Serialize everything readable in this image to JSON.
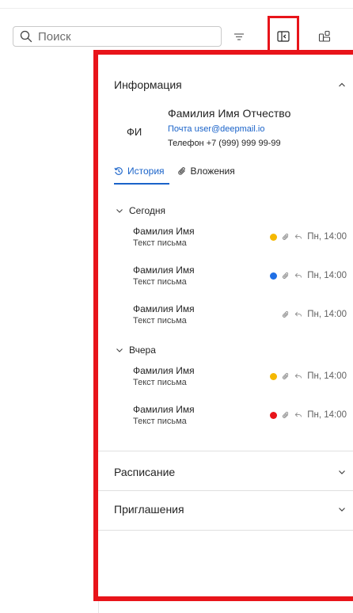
{
  "search": {
    "placeholder": "Поиск"
  },
  "panel": {
    "info_section": {
      "title": "Информация",
      "fio_label": "ФИ",
      "full_name": "Фамилия Имя Отчество",
      "email_label": "Почта",
      "email": "user@deepmail.io",
      "phone_label": "Телефон",
      "phone": "+7 (999) 999 99-99"
    },
    "tabs": [
      {
        "label": "История",
        "icon": "history-icon",
        "active": true
      },
      {
        "label": "Вложения",
        "icon": "paperclip-icon",
        "active": false
      }
    ],
    "groups": [
      {
        "label": "Сегодня",
        "items": [
          {
            "sender": "Фамилия Имя",
            "snippet": "Текст письма",
            "dot_color": "#f5b800",
            "time": "Пн, 14:00"
          },
          {
            "sender": "Фамилия Имя",
            "snippet": "Текст письма",
            "dot_color": "#1f6fe5",
            "time": "Пн, 14:00"
          },
          {
            "sender": "Фамилия Имя",
            "snippet": "Текст письма",
            "dot_color": "",
            "time": "Пн, 14:00"
          }
        ]
      },
      {
        "label": "Вчера",
        "items": [
          {
            "sender": "Фамилия Имя",
            "snippet": "Текст письма",
            "dot_color": "#f5b800",
            "time": "Пн, 14:00"
          },
          {
            "sender": "Фамилия Имя",
            "snippet": "Текст письма",
            "dot_color": "#e8141a",
            "time": "Пн, 14:00"
          }
        ]
      }
    ],
    "schedule_section": {
      "title": "Расписание"
    },
    "invitations_section": {
      "title": "Приглашения"
    }
  },
  "colors": {
    "accent": "#1a63c9",
    "highlight": "#e8141a"
  }
}
